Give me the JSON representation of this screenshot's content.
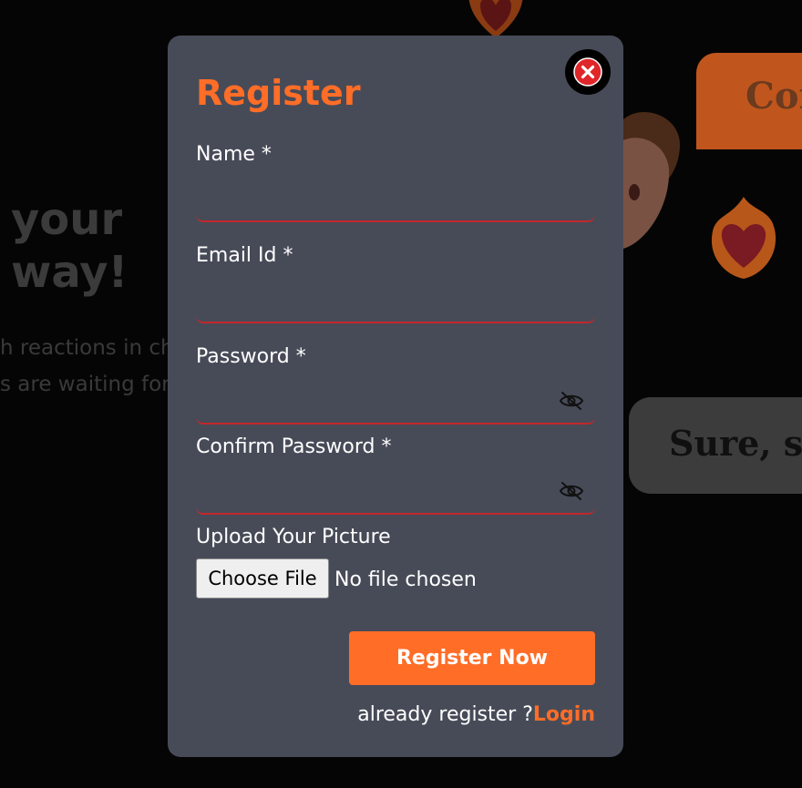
{
  "background": {
    "heading_line1": "your",
    "heading_line2": "way!",
    "sub_line1": "h reactions in ch",
    "sub_line2": "s are waiting for",
    "bubble_orange_text": "Cof",
    "bubble_grey_text": "Sure, se"
  },
  "modal": {
    "title": "Register",
    "fields": [
      {
        "label": "Name *",
        "value": "",
        "type": "text"
      },
      {
        "label": "Email Id *",
        "value": "",
        "type": "email"
      },
      {
        "label": "Password *",
        "value": "",
        "type": "password"
      },
      {
        "label": "Confirm Password *",
        "value": "",
        "type": "password"
      }
    ],
    "upload": {
      "label": "Upload Your Picture",
      "button_label": "Choose File",
      "status": "No file chosen"
    },
    "submit_label": "Register Now",
    "footer_text": "already register ?",
    "login_label": "Login"
  },
  "icons": {
    "close": "close-icon",
    "password_toggle": "eye-off-icon"
  },
  "colors": {
    "accent": "#ff6d27",
    "modal_bg": "#474b58",
    "input_underline": "#c4272b",
    "close_red": "#e0262a"
  }
}
